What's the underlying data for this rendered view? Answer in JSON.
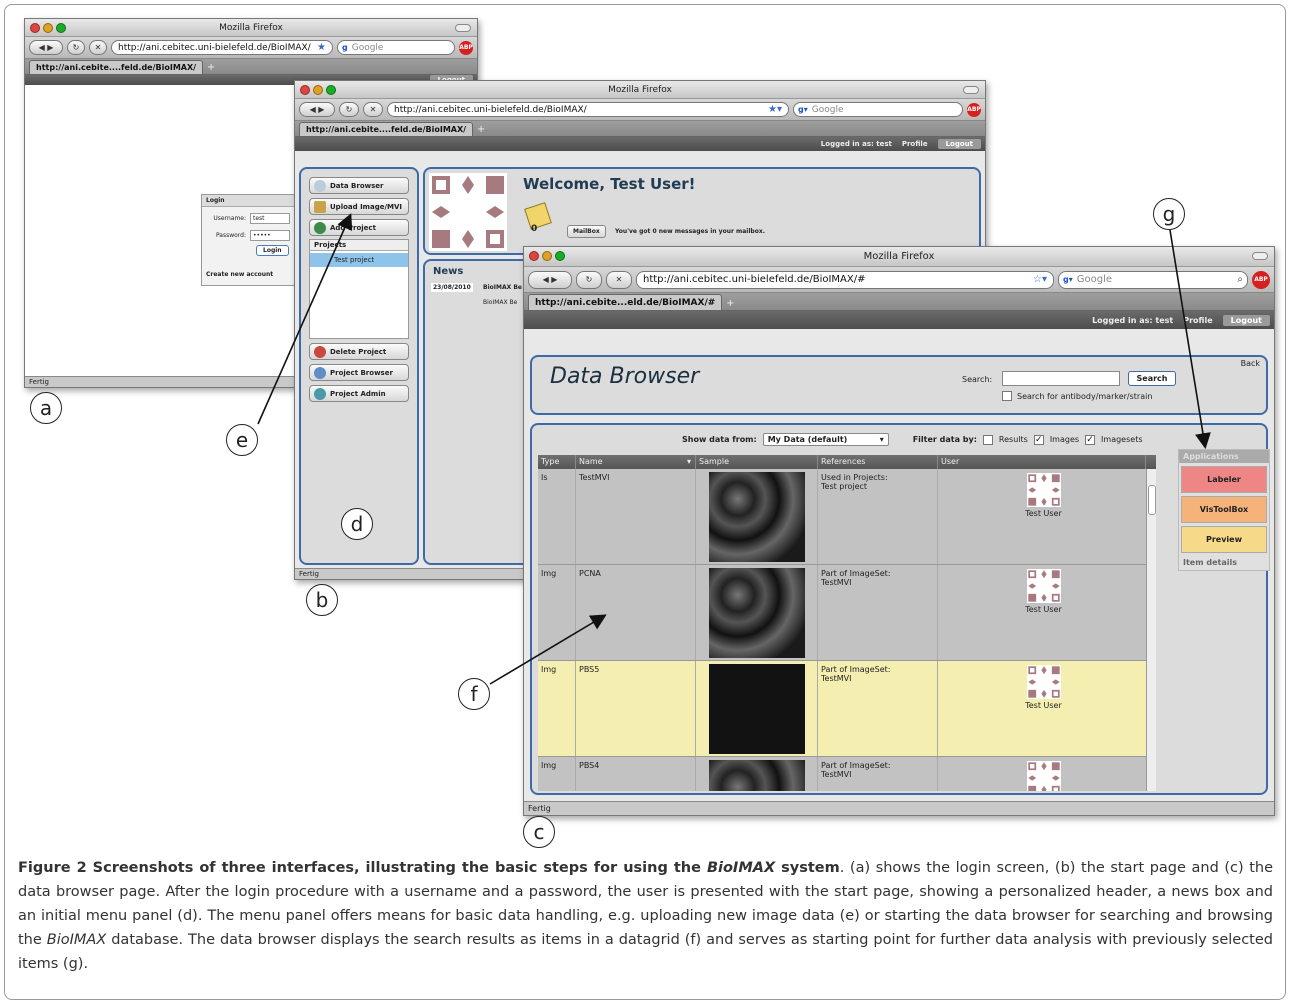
{
  "windows": {
    "a": {
      "title": "Mozilla Firefox",
      "url": "http://ani.cebitec.uni-bielefeld.de/BioIMAX/",
      "search_placeholder": "Google",
      "tab_label": "http://ani.cebite....feld.de/BioIMAX/",
      "header_logout": "Logout",
      "status": "Fertig",
      "login": {
        "title": "Login",
        "username_label": "Username:",
        "username_value": "test",
        "password_label": "Password:",
        "password_value": "•••••",
        "button": "Login",
        "create_account": "Create new account"
      }
    },
    "b": {
      "title": "Mozilla Firefox",
      "url": "http://ani.cebitec.uni-bielefeld.de/BioIMAX/",
      "search_placeholder": "Google",
      "tab_label": "http://ani.cebite....feld.de/BioIMAX/",
      "header_logged": "Logged in as: test",
      "header_profile": "Profile",
      "header_logout": "Logout",
      "status": "Fertig",
      "menu": [
        {
          "label": "Data Browser"
        },
        {
          "label": "Upload Image/MVI"
        },
        {
          "label": "Add Project"
        }
      ],
      "menu_bottom": [
        {
          "label": "Delete Project"
        },
        {
          "label": "Project Browser"
        },
        {
          "label": "Project Admin"
        }
      ],
      "projects_header": "Projects",
      "project_item": "Test project",
      "welcome": "Welcome, Test User!",
      "mail_count": "0",
      "mailbox_button": "MailBox",
      "mail_message": "You've got 0 new messages in your mailbox.",
      "news_title": "News",
      "news_date": "23/08/2010",
      "news_text": "BioIMAX Be",
      "news_text2": "BioIMAX Be"
    },
    "c": {
      "title": "Mozilla Firefox",
      "url": "http://ani.cebitec.uni-bielefeld.de/BioIMAX/#",
      "search_placeholder": "Google",
      "tab_label": "http://ani.cebite...eld.de/BioIMAX/#",
      "header_logged": "Logged in as: test",
      "header_profile": "Profile",
      "header_logout": "Logout",
      "status": "Fertig",
      "page_title": "Data Browser",
      "back": "Back",
      "search_label": "Search:",
      "search_button": "Search",
      "search_antibody": "Search for antibody/marker/strain",
      "show_from_label": "Show data from:",
      "show_from_value": "My Data (default)",
      "filter_label": "Filter data by:",
      "filters": [
        {
          "label": "Results",
          "checked": false
        },
        {
          "label": "Images",
          "checked": true
        },
        {
          "label": "Imagesets",
          "checked": true
        }
      ],
      "columns": [
        "Type",
        "Name",
        "Sample",
        "References",
        "User"
      ],
      "rows": [
        {
          "type": "Is",
          "name": "TestMVI",
          "ref1": "Used in Projects:",
          "ref2": "Test project",
          "user": "Test User",
          "bg": "#c2c2c2",
          "dark": false
        },
        {
          "type": "Img",
          "name": "PCNA",
          "ref1": "Part of ImageSet:",
          "ref2": "TestMVI",
          "user": "Test User",
          "bg": "#c2c2c2",
          "dark": false
        },
        {
          "type": "Img",
          "name": "PBS5",
          "ref1": "Part of ImageSet:",
          "ref2": "TestMVI",
          "user": "Test User",
          "bg": "#f4efb0",
          "dark": true
        },
        {
          "type": "Img",
          "name": "PBS4",
          "ref1": "Part of ImageSet:",
          "ref2": "TestMVI",
          "user": "",
          "bg": "#c2c2c2",
          "dark": false
        }
      ],
      "apps": {
        "header": "Applications",
        "buttons": [
          {
            "label": "Labeler",
            "color": "#ef8686"
          },
          {
            "label": "VisToolBox",
            "color": "#f5b37a"
          },
          {
            "label": "Preview",
            "color": "#f7d98a"
          }
        ],
        "item_details": "Item details"
      }
    }
  },
  "callouts": [
    "a",
    "b",
    "c",
    "d",
    "e",
    "f",
    "g"
  ],
  "caption": {
    "lead": "Figure 2 Screenshots of three interfaces, illustrating the basic steps for using the ",
    "lead_italic": "BioIMAX",
    "lead_end": " system",
    "body1": ". (a) shows the login screen, (b) the start page and (c) the data browser page. After the login procedure with a username and a password, the user is presented with the start page, showing a personalized header, a news box and an initial menu panel (d). The menu panel offers means for basic data handling, e.g. uploading new image data (e) or starting the data browser for searching and browsing the ",
    "body_italic": "BioIMAX",
    "body2": " database. The data browser displays the search results as items in a datagrid (f) and serves as starting point for further data analysis with previously selected items (g)."
  },
  "colors": {
    "panel_border": "#3e6aa8",
    "highlight_row": "#f4efb0",
    "project_selected": "#8ec3ea",
    "logo_color": "#a77a7f"
  }
}
